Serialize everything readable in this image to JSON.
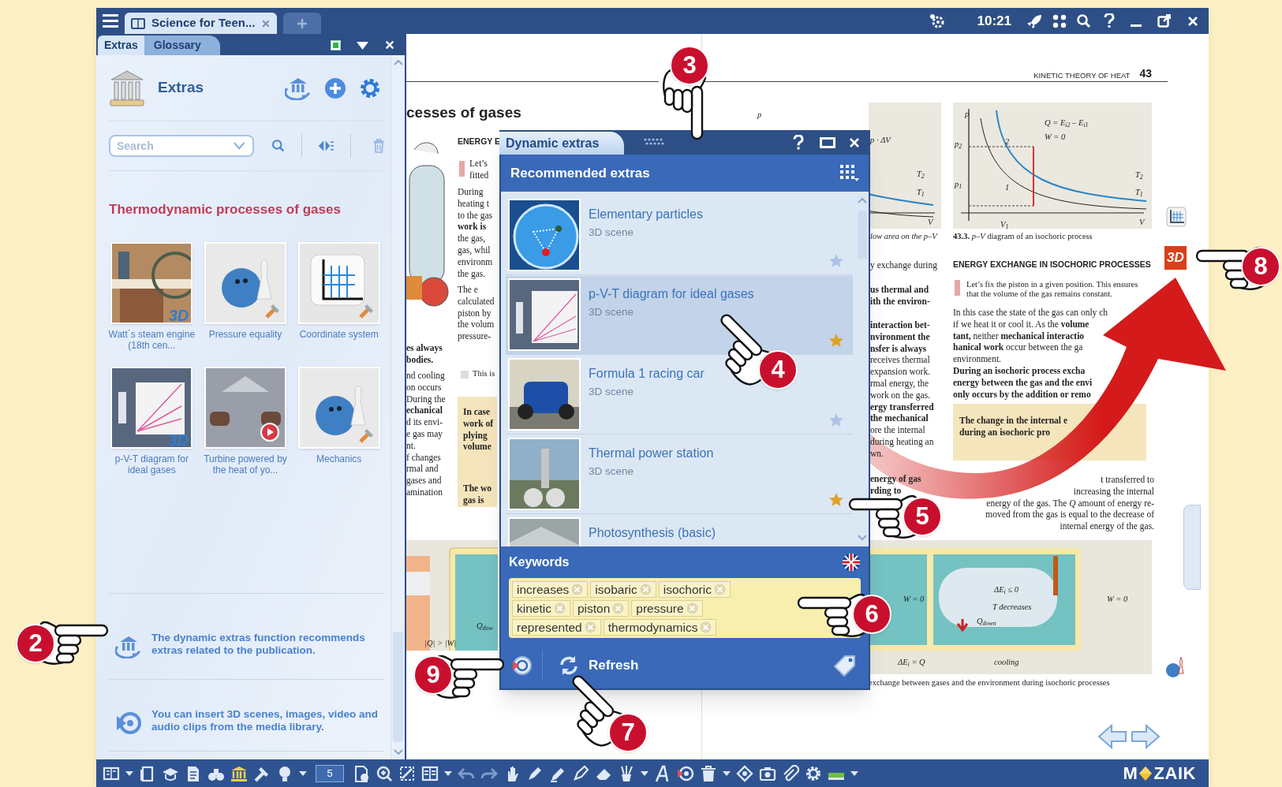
{
  "app_tabs": [
    {
      "label": "Science for Teen...",
      "selected": true
    }
  ],
  "title_bar": {
    "time": "10:21"
  },
  "side_panel": {
    "tabs": [
      {
        "label": "Extras",
        "selected": true
      },
      {
        "label": "Glossary",
        "selected": false
      }
    ],
    "title": "Extras",
    "search": {
      "placeholder": "Search"
    },
    "section_title": "Thermodynamic processes of gases",
    "extras": [
      {
        "label": "Watt´s steam engine (18th cen...",
        "kind": "scene3d",
        "badge": "3D"
      },
      {
        "label": "Pressure equality",
        "kind": "tool"
      },
      {
        "label": "Coordinate system",
        "kind": "tool"
      },
      {
        "label": "p-V-T diagram for ideal gases",
        "kind": "scene3d",
        "badge": "3D"
      },
      {
        "label": "Turbine powered by the heat of yo...",
        "kind": "video"
      },
      {
        "label": "Mechanics",
        "kind": "tool"
      }
    ],
    "tips": [
      {
        "kind": "dynamic",
        "text": "The dynamic extras function recommends extras related to the publication."
      },
      {
        "kind": "media",
        "text": "You can insert 3D scenes, images, video and audio clips from the media library."
      }
    ]
  },
  "book": {
    "running_head": "KINETIC THEORY OF HEAT",
    "page_number": "43",
    "badge_3d": "3D",
    "blocks": [
      {
        "kind": "heading",
        "lines": [
          "cesses of gases"
        ]
      },
      {
        "kind": "bold",
        "lines": [
          "es always",
          "bodies."
        ]
      },
      {
        "kind": "body",
        "lines": [
          "nd cooling",
          "on occurs",
          "During the",
          "**echanical**",
          "d its envi-",
          "e gas may",
          "nt.",
          "f changes",
          "rmal and",
          "gases and",
          "amination"
        ]
      },
      {
        "kind": "subhead",
        "lines": [
          "ENERGY E"
        ]
      },
      {
        "kind": "body",
        "lines": [
          "Let’s",
          "fitted"
        ]
      },
      {
        "kind": "body",
        "lines": [
          "During",
          "heating t",
          "to the gas",
          "**work is**",
          "the gas,",
          "gas, whil",
          "environm",
          "the gas."
        ]
      },
      {
        "kind": "body",
        "lines": [
          "The e",
          "calculated",
          "piston by",
          "the volum",
          "pressure-"
        ]
      },
      {
        "kind": "small",
        "lines": [
          "This is"
        ]
      },
      {
        "kind": "bold",
        "lines": [
          "In case",
          "work of",
          "plying",
          "volume"
        ]
      },
      {
        "kind": "bold",
        "lines": [
          "The wo",
          "gas is"
        ]
      },
      {
        "kind": "caption",
        "lines": [
          "*low area on the p–V*"
        ]
      },
      {
        "kind": "caption",
        "lines": [
          "**43.3.** *p–V* diagram of an isochoric process"
        ]
      },
      {
        "kind": "body",
        "lines": [
          "y exchange during"
        ]
      },
      {
        "kind": "bold",
        "lines": [
          "us thermal and",
          "ith the environ-"
        ]
      },
      {
        "kind": "body",
        "lines": [
          "**interaction bet-**",
          "**nvironment the**",
          "**nsfer is always**",
          "receives thermal",
          "expansion work.",
          "rmal energy, the",
          "work on the gas.",
          "**ergy transferred**",
          "**the mechanical**",
          "ore the internal",
          "during heating an",
          "wn."
        ]
      },
      {
        "kind": "bold",
        "lines": [
          "energy of gas",
          "rding to"
        ]
      },
      {
        "kind": "subhead",
        "lines": [
          "ENERGY EXCHANGE IN ISOCHORIC PROCESSES"
        ]
      },
      {
        "kind": "small",
        "lines": [
          "Let’s fix the piston in a given position. This ensures",
          "that the volume of the gas remains constant."
        ]
      },
      {
        "kind": "body",
        "lines": [
          "In this case the state of the gas can only ch",
          "if we heat it or cool it. As the **volume**",
          "**tant,** neither **mechanical interactio**",
          "**hanical work** occur between the ga",
          "environment."
        ]
      },
      {
        "kind": "bold",
        "lines": [
          "During an isochoric process excha",
          "energy between the gas and the envi",
          "only occurs by the addition or remo"
        ]
      },
      {
        "kind": "bold",
        "lines": [
          "The change in the internal e",
          "during an isochoric pro"
        ]
      },
      {
        "kind": "body",
        "lines": [
          "t transferred to",
          "increasing the internal",
          "energy of the gas. The *Q* amount of energy re-",
          "moved from the gas is equal to the decrease of",
          "internal energy of the gas."
        ]
      },
      {
        "kind": "small",
        "lines": [
          "exchange between gases and the environment during isochoric processes"
        ]
      }
    ],
    "labels": [
      "p",
      "p · ΔV",
      "T$_{2}$",
      "T$_{1}$",
      "V",
      "p",
      "Q = E$_{i2}$ – E$_{i1}$",
      "W = 0",
      "p$_{2}$",
      "2",
      "T$_{2}$",
      "p$_{1}$",
      "1",
      "T$_{1}$",
      "V$_{1}$",
      "V",
      "|Q| > |W|",
      "Q$_{dow}$",
      "W = 0",
      "ΔE$_{i}$ = Q",
      "ΔE$_{i}$ ≤ 0",
      "T decreases",
      "Q$_{down}$",
      "cooling",
      "W = 0"
    ]
  },
  "dynamic_extras": {
    "title": "Dynamic extras",
    "header": "Recommended extras",
    "items": [
      {
        "title": "Elementary particles",
        "subtitle": "3D scene",
        "favorite": false,
        "selected": false
      },
      {
        "title": "p-V-T diagram for ideal gases",
        "subtitle": "3D scene",
        "favorite": true,
        "selected": true
      },
      {
        "title": "Formula 1 racing car",
        "subtitle": "3D scene",
        "favorite": false,
        "selected": false
      },
      {
        "title": "Thermal power station",
        "subtitle": "3D scene",
        "favorite": true,
        "selected": false
      },
      {
        "title": "Photosynthesis (basic)",
        "selected": false
      }
    ],
    "keywords_title": "Keywords",
    "keywords": [
      "increases",
      "isobaric",
      "isochoric",
      "kinetic",
      "piston",
      "pressure",
      "represented",
      "thermodynamics"
    ],
    "refresh": "Refresh"
  },
  "toolbar": {
    "page": "5",
    "logo_left": "M",
    "logo_right": "ZAIK"
  },
  "callouts": [
    {
      "number": "3"
    },
    {
      "number": "8"
    },
    {
      "number": "4"
    },
    {
      "number": "5"
    },
    {
      "number": "6"
    },
    {
      "number": "2"
    },
    {
      "number": "9"
    },
    {
      "number": "7"
    }
  ]
}
